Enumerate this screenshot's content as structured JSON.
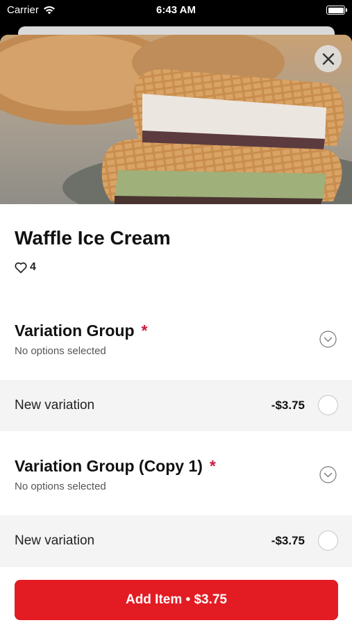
{
  "status_bar": {
    "carrier": "Carrier",
    "time": "6:43 AM",
    "icons": [
      "wifi-icon",
      "battery-icon"
    ]
  },
  "hero": {
    "close_icon": "close-icon"
  },
  "product": {
    "title": "Waffle Ice Cream",
    "likes": "4",
    "like_icon": "heart-icon"
  },
  "groups": [
    {
      "title": "Variation Group",
      "required_mark": "*",
      "subtitle": "No options selected",
      "options": [
        {
          "label": "New variation",
          "price": "-$3.75",
          "selected": false
        }
      ]
    },
    {
      "title": "Variation Group (Copy 1)",
      "required_mark": "*",
      "subtitle": "No options selected",
      "options": [
        {
          "label": "New variation",
          "price": "-$3.75",
          "selected": false
        }
      ]
    }
  ],
  "footer": {
    "add_button_label": "Add Item • $3.75"
  },
  "colors": {
    "accent": "#e31b23",
    "required": "#c81e3c",
    "row_background": "#f4f4f4"
  }
}
